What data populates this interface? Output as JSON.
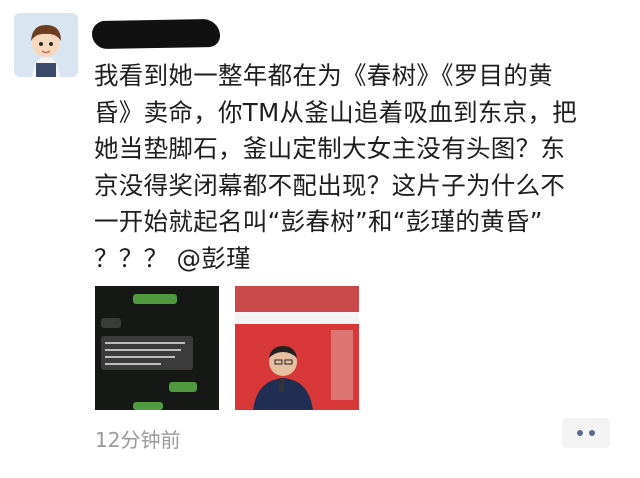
{
  "post": {
    "text_lines": [
      "我看到她一整年都在为《春树》《罗目的黄",
      "昏》卖命，你TM从釜山追着吸血到东京，把",
      "她当垫脚石，釜山定制大女主没有头图？东",
      "京没得奖闭幕都不配出现？这片子为什么不",
      "一开始就起名叫“彭春树”和“彭瑾的黄昏”"
    ],
    "last_line_prefix": "？？？ ",
    "mention": "@彭瑾",
    "timestamp": "12分钟前"
  },
  "images": [
    {
      "type": "chat-screenshot"
    },
    {
      "type": "photo"
    }
  ],
  "icons": {
    "avatar": "cartoon-boy-avatar",
    "more": "more-dots-icon"
  },
  "colors": {
    "text": "#1e1e1e",
    "timestamp": "#9a9a9a",
    "more_dots": "#5a6a8a"
  }
}
